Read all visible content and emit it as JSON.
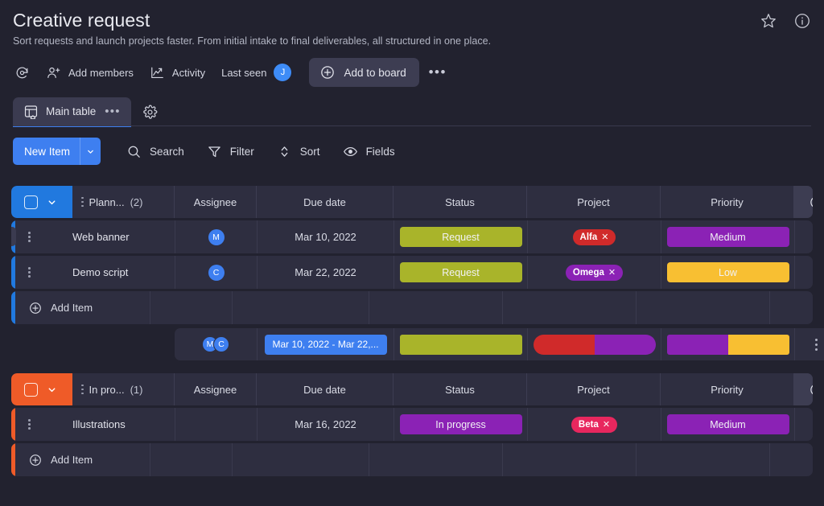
{
  "header": {
    "title": "Creative request",
    "subtitle": "Sort requests and launch projects faster. From initial intake to final deliverables, all structured in one place.",
    "favorite_icon": "star-icon",
    "info_icon": "info-icon"
  },
  "meta_bar": {
    "refresh_icon": "activity-refresh-icon",
    "add_members_label": "Add members",
    "activity_label": "Activity",
    "last_seen_label": "Last seen",
    "last_seen_avatar": "J",
    "add_to_board_label": "Add to board",
    "more_label": "•••"
  },
  "tabs": {
    "main_table_label": "Main table",
    "tab_dots": "•••",
    "settings_icon": "gear-icon"
  },
  "toolbar": {
    "new_item_label": "New Item",
    "search_label": "Search",
    "filter_label": "Filter",
    "sort_label": "Sort",
    "fields_label": "Fields",
    "accent_color": "#3e7ff0"
  },
  "columns": {
    "name": "",
    "assignee": "Assignee",
    "due_date": "Due date",
    "status": "Status",
    "project": "Project",
    "priority": "Priority"
  },
  "groups": [
    {
      "name": "Plann...",
      "count": "(2)",
      "color": "#2179df",
      "add_item_label": "Add Item",
      "rows": [
        {
          "name": "Web banner",
          "assignee": "M",
          "due_date": "Mar 10, 2022",
          "status": "Request",
          "status_color": "#a9b42a",
          "project": "Alfa",
          "project_color": "#d02a2a",
          "project_remove": "✕",
          "priority": "Medium",
          "priority_color": "#8b22b5"
        },
        {
          "name": "Demo script",
          "assignee": "C",
          "due_date": "Mar 22, 2022",
          "status": "Request",
          "status_color": "#a9b42a",
          "project": "Omega",
          "project_color": "#8b22b5",
          "project_remove": "✕",
          "priority": "Low",
          "priority_color": "#f8bf32"
        }
      ],
      "summary": {
        "avatars": [
          "M",
          "C"
        ],
        "date_range": "Mar 10, 2022 - Mar 22,...",
        "status_bar": [
          {
            "color": "#a9b42a",
            "pct": 100
          }
        ],
        "project_bar": [
          {
            "color": "#d02a2a",
            "pct": 50
          },
          {
            "color": "#8b22b5",
            "pct": 50
          }
        ],
        "priority_bar": [
          {
            "color": "#8b22b5",
            "pct": 50
          },
          {
            "color": "#f8bf32",
            "pct": 50
          }
        ],
        "menu_icon": "vertical-dots-icon"
      }
    },
    {
      "name": "In pro...",
      "count": "(1)",
      "color": "#ef5b28",
      "add_item_label": "Add Item",
      "rows": [
        {
          "name": "Illustrations",
          "assignee": "",
          "due_date": "Mar 16, 2022",
          "status": "In progress",
          "status_color": "#8b22b5",
          "project": "Beta",
          "project_color": "#e8275e",
          "project_remove": "✕",
          "priority": "Medium",
          "priority_color": "#8b22b5"
        }
      ]
    }
  ]
}
